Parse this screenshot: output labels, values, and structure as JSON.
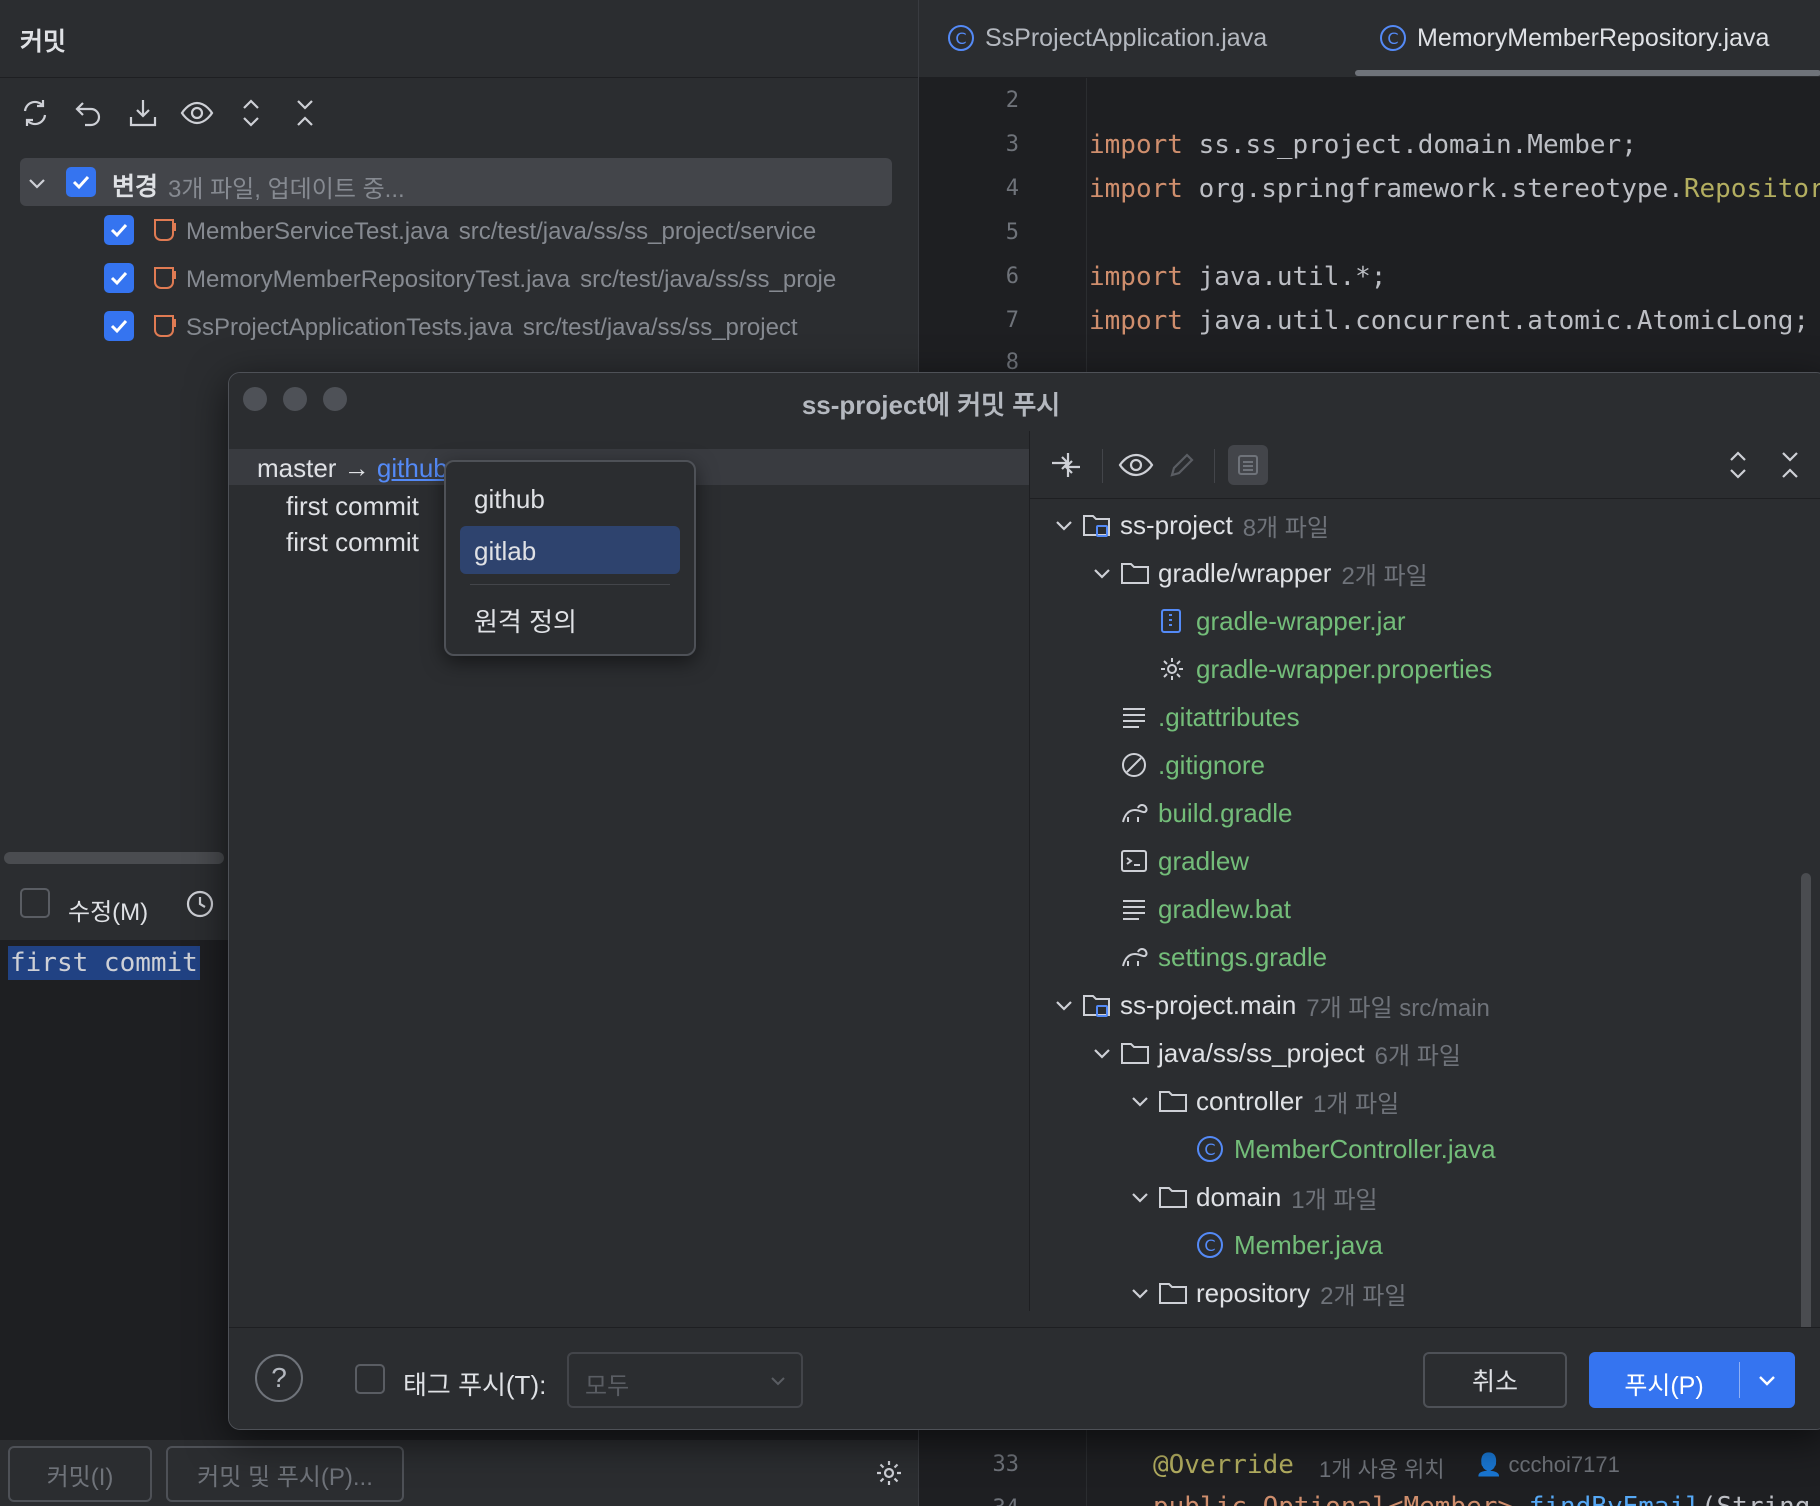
{
  "commit_panel": {
    "title": "커밋",
    "changes_label": "변경",
    "changes_info": "3개 파일, 업데이트 중...",
    "files": [
      {
        "name": "MemberServiceTest.java",
        "path": "src/test/java/ss/ss_project/service"
      },
      {
        "name": "MemoryMemberRepositoryTest.java",
        "path": "src/test/java/ss/ss_proje"
      },
      {
        "name": "SsProjectApplicationTests.java",
        "path": "src/test/java/ss/ss_project"
      }
    ],
    "amend_label": "수정(M)",
    "commit_message": "first commit",
    "commit_button": "커밋(I)",
    "commit_push_button": "커밋 및 푸시(P)..."
  },
  "editor": {
    "tabs": [
      {
        "label": "SsProjectApplication.java"
      },
      {
        "label": "MemoryMemberRepository.java"
      }
    ],
    "lines": [
      {
        "n": "2",
        "kw": "",
        "text": ""
      },
      {
        "n": "3",
        "kw": "import",
        "text": " ss.ss_project.domain.Member;"
      },
      {
        "n": "4",
        "kw": "import",
        "text": " org.springframework.stereotype.",
        "tail": "Repositor"
      },
      {
        "n": "5",
        "kw": "",
        "text": ""
      },
      {
        "n": "6",
        "kw": "import",
        "text": " java.util.*;"
      },
      {
        "n": "7",
        "kw": "import",
        "text": " java.util.concurrent.atomic.AtomicLong;"
      },
      {
        "n": "8",
        "kw": "",
        "text": ""
      }
    ],
    "bottom_line_number": "33",
    "bottom_annotation": "@Override",
    "usage_hint": "1개 사용 위치",
    "author_hint": "ccchoi7171",
    "next_line_number": "34",
    "next_line_code": "public Optional<Member> ",
    "next_line_fn": "findByEmail",
    "next_line_tail": "(String"
  },
  "dialog": {
    "title": "ss-project에 커밋 푸시",
    "branch_local": "master → ",
    "branch_remote": "github",
    "commits": [
      "first commit",
      "first commit"
    ],
    "remote_options": [
      "github",
      "gitlab",
      "원격 정의"
    ],
    "selected_remote": "gitlab",
    "tree": [
      {
        "depth": 0,
        "expand": true,
        "icon": "module",
        "name": "ss-project",
        "count": "8개 파일",
        "color": "white"
      },
      {
        "depth": 1,
        "expand": true,
        "icon": "folder",
        "name": "gradle/wrapper",
        "count": "2개 파일",
        "color": "white"
      },
      {
        "depth": 2,
        "expand": false,
        "icon": "jar",
        "name": "gradle-wrapper.jar",
        "count": "",
        "color": "green"
      },
      {
        "depth": 2,
        "expand": false,
        "icon": "gear",
        "name": "gradle-wrapper.properties",
        "count": "",
        "color": "green"
      },
      {
        "depth": 1,
        "expand": false,
        "icon": "text",
        "name": ".gitattributes",
        "count": "",
        "color": "green"
      },
      {
        "depth": 1,
        "expand": false,
        "icon": "ignore",
        "name": ".gitignore",
        "count": "",
        "color": "green"
      },
      {
        "depth": 1,
        "expand": false,
        "icon": "gradle",
        "name": "build.gradle",
        "count": "",
        "color": "green"
      },
      {
        "depth": 1,
        "expand": false,
        "icon": "terminal",
        "name": "gradlew",
        "count": "",
        "color": "green"
      },
      {
        "depth": 1,
        "expand": false,
        "icon": "text",
        "name": "gradlew.bat",
        "count": "",
        "color": "green"
      },
      {
        "depth": 1,
        "expand": false,
        "icon": "gradle",
        "name": "settings.gradle",
        "count": "",
        "color": "green"
      },
      {
        "depth": 0,
        "expand": true,
        "icon": "module",
        "name": "ss-project.main",
        "count": "7개 파일  src/main",
        "color": "white"
      },
      {
        "depth": 1,
        "expand": true,
        "icon": "folder",
        "name": "java/ss/ss_project",
        "count": "6개 파일",
        "color": "white"
      },
      {
        "depth": 2,
        "expand": true,
        "icon": "folder",
        "name": "controller",
        "count": "1개 파일",
        "color": "white"
      },
      {
        "depth": 3,
        "expand": false,
        "icon": "class",
        "name": "MemberController.java",
        "count": "",
        "color": "green"
      },
      {
        "depth": 2,
        "expand": true,
        "icon": "folder",
        "name": "domain",
        "count": "1개 파일",
        "color": "white"
      },
      {
        "depth": 3,
        "expand": false,
        "icon": "class",
        "name": "Member.java",
        "count": "",
        "color": "green"
      },
      {
        "depth": 2,
        "expand": true,
        "icon": "folder",
        "name": "repository",
        "count": "2개 파일",
        "color": "white"
      }
    ],
    "help": "?",
    "tag_push_label": "태그 푸시(T):",
    "tag_select_value": "모두",
    "cancel_button": "취소",
    "push_button": "푸시(P)"
  },
  "colors": {
    "accent": "#3574f0",
    "added_file": "#73bd79",
    "selection": "#2e436e"
  }
}
